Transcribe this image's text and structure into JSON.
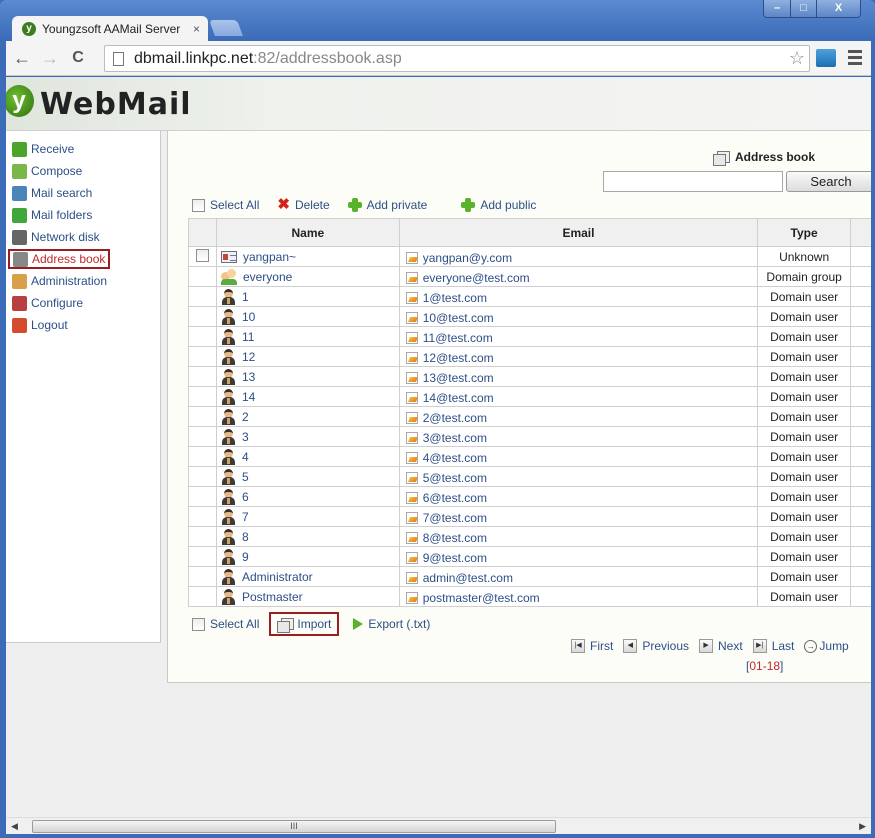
{
  "browser": {
    "tab_title": "Youngzsoft AAMail Server",
    "tab_close": "×",
    "url_host": "dbmail.linkpc.net",
    "url_path": ":82/addressbook.asp",
    "window_buttons": {
      "minimize": "–",
      "maximize": "□",
      "close": "X"
    },
    "nav": {
      "back": "←",
      "forward": "→",
      "reload": "C"
    },
    "star": "☆"
  },
  "header": {
    "logo_letter": "y",
    "logo_text": "WebMail"
  },
  "sidebar": {
    "items": [
      {
        "label": "Receive",
        "icon": "receive-icon",
        "color": "#4ba52b"
      },
      {
        "label": "Compose",
        "icon": "compose-icon",
        "color": "#7ab648"
      },
      {
        "label": "Mail search",
        "icon": "search-icon",
        "color": "#4a86b8"
      },
      {
        "label": "Mail folders",
        "icon": "folders-icon",
        "color": "#3fa83a"
      },
      {
        "label": "Network disk",
        "icon": "disk-icon",
        "color": "#666666"
      },
      {
        "label": "Address book",
        "icon": "address-book-icon",
        "color": "#888888",
        "active": true
      },
      {
        "label": "Administration",
        "icon": "admin-icon",
        "color": "#d9a04a"
      },
      {
        "label": "Configure",
        "icon": "configure-icon",
        "color": "#b84040"
      },
      {
        "label": "Logout",
        "icon": "logout-icon",
        "color": "#d54c2c"
      }
    ]
  },
  "main": {
    "title": "Address book",
    "search": {
      "value": "",
      "placeholder": "",
      "button": "Search"
    },
    "actions": {
      "select_all": "Select All",
      "delete": "Delete",
      "add_private": "Add private",
      "add_public": "Add public"
    },
    "columns": [
      "Name",
      "Email",
      "Type"
    ],
    "rows": [
      {
        "name": "yangpan~",
        "email": "yangpan@y.com",
        "type": "Unknown",
        "kind": "card",
        "checkbox": true
      },
      {
        "name": "everyone",
        "email": "everyone@test.com",
        "type": "Domain group",
        "kind": "group"
      },
      {
        "name": "1",
        "email": "1@test.com",
        "type": "Domain user",
        "kind": "user"
      },
      {
        "name": "10",
        "email": "10@test.com",
        "type": "Domain user",
        "kind": "user"
      },
      {
        "name": "11",
        "email": "11@test.com",
        "type": "Domain user",
        "kind": "user"
      },
      {
        "name": "12",
        "email": "12@test.com",
        "type": "Domain user",
        "kind": "user"
      },
      {
        "name": "13",
        "email": "13@test.com",
        "type": "Domain user",
        "kind": "user"
      },
      {
        "name": "14",
        "email": "14@test.com",
        "type": "Domain user",
        "kind": "user"
      },
      {
        "name": "2",
        "email": "2@test.com",
        "type": "Domain user",
        "kind": "user"
      },
      {
        "name": "3",
        "email": "3@test.com",
        "type": "Domain user",
        "kind": "user"
      },
      {
        "name": "4",
        "email": "4@test.com",
        "type": "Domain user",
        "kind": "user"
      },
      {
        "name": "5",
        "email": "5@test.com",
        "type": "Domain user",
        "kind": "user"
      },
      {
        "name": "6",
        "email": "6@test.com",
        "type": "Domain user",
        "kind": "user"
      },
      {
        "name": "7",
        "email": "7@test.com",
        "type": "Domain user",
        "kind": "user"
      },
      {
        "name": "8",
        "email": "8@test.com",
        "type": "Domain user",
        "kind": "user"
      },
      {
        "name": "9",
        "email": "9@test.com",
        "type": "Domain user",
        "kind": "user"
      },
      {
        "name": "Administrator",
        "email": "admin@test.com",
        "type": "Domain user",
        "kind": "user"
      },
      {
        "name": "Postmaster",
        "email": "postmaster@test.com",
        "type": "Domain user",
        "kind": "user"
      }
    ],
    "bottom": {
      "select_all": "Select All",
      "import": "Import",
      "export": "Export (.txt)"
    },
    "pager": {
      "first": "First",
      "previous": "Previous",
      "next": "Next",
      "last": "Last",
      "jump": "Jump",
      "range_open": "[",
      "range": "01-18",
      "range_close": "]"
    }
  },
  "scrollbar": {
    "grip": "III",
    "left": "◀",
    "right": "▶"
  }
}
